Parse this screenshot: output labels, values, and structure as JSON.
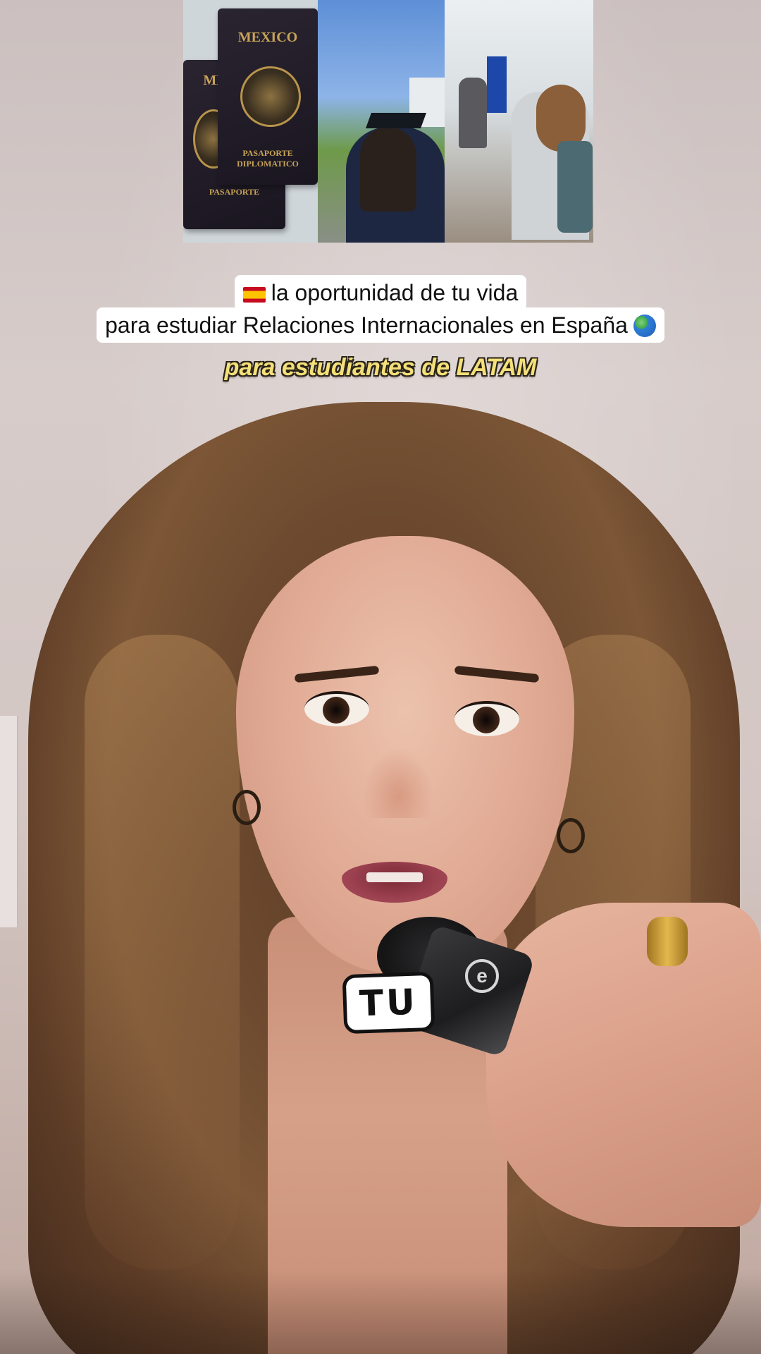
{
  "collage": {
    "passport_front_title": "MEXICO",
    "passport_front_type": "PASAPORTE DIPLOMATICO",
    "passport_back_title": "MÉ",
    "passport_back_type": "PASAPORTE"
  },
  "caption": {
    "line1": "la oportunidad de tu vida",
    "line2": "para estudiar Relaciones Internacionales en España"
  },
  "subtitle": "para estudiantes de LATAM",
  "sticker_text": "TU",
  "mic_logo": "e"
}
